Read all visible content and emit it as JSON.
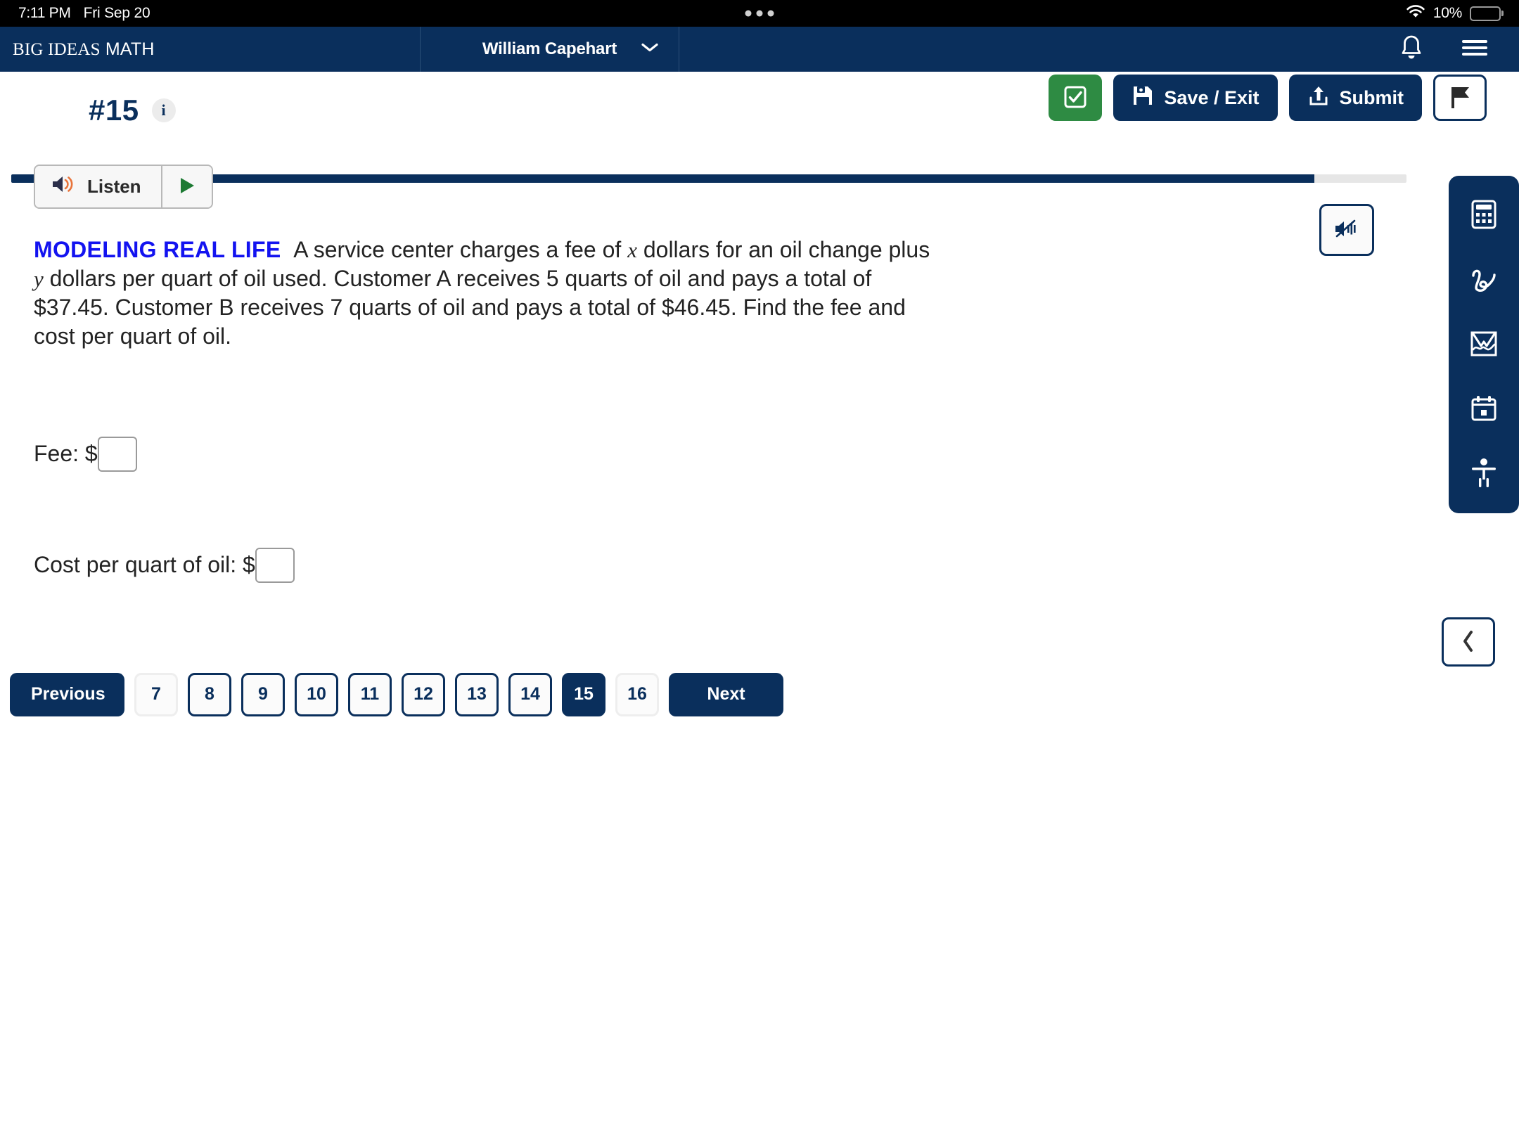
{
  "status_bar": {
    "time": "7:11 PM",
    "date": "Fri Sep 20",
    "battery_percent": "10%",
    "wifi_icon": "wifi-icon",
    "battery_icon": "battery-icon"
  },
  "header": {
    "brand_primary": "BIG IDEAS",
    "brand_secondary": "MATH",
    "user_name": "William Capehart",
    "user_caret_icon": "chevron-down-icon",
    "notification_icon": "bell-icon",
    "menu_icon": "hamburger-menu-icon"
  },
  "question_bar": {
    "number": "#15",
    "info_icon": "i",
    "check_label": "check-answer",
    "save_exit_label": "Save / Exit",
    "submit_label": "Submit",
    "flag_label": "flag-question",
    "progress_percent": 93.4
  },
  "audio": {
    "listen_label": "Listen",
    "speaker_icon": "speaker-icon",
    "play_icon": "play-icon",
    "mute_icon": "speaker-mute-icon"
  },
  "question": {
    "tag": "MODELING REAL LIFE",
    "part1": "A service center charges a fee of ",
    "var_x": "x",
    "part2": " dollars for an oil change plus ",
    "var_y": "y",
    "part3": " dollars per quart of oil used. Customer A receives 5 quarts of oil and pays a total of $37.45. Customer B receives 7 quarts of oil and pays a total of $46.45. Find the fee and cost per quart of oil."
  },
  "answers": [
    {
      "label": "Fee: $",
      "value": "",
      "name": "fee-input"
    },
    {
      "label": "Cost per quart of oil: $",
      "value": "",
      "name": "cost-per-quart-input"
    }
  ],
  "pagination": {
    "previous_label": "Previous",
    "next_label": "Next",
    "pages": [
      {
        "label": "7",
        "state": "muted"
      },
      {
        "label": "8",
        "state": "normal"
      },
      {
        "label": "9",
        "state": "normal"
      },
      {
        "label": "10",
        "state": "normal"
      },
      {
        "label": "11",
        "state": "normal"
      },
      {
        "label": "12",
        "state": "normal"
      },
      {
        "label": "13",
        "state": "normal"
      },
      {
        "label": "14",
        "state": "normal"
      },
      {
        "label": "15",
        "state": "active"
      },
      {
        "label": "16",
        "state": "muted"
      }
    ]
  },
  "tool_rail": {
    "items": [
      {
        "name": "calculator-icon",
        "label": "Calculator"
      },
      {
        "name": "scribble-icon",
        "label": "Scratchpad"
      },
      {
        "name": "graph-icon",
        "label": "Graphing Tool"
      },
      {
        "name": "tools-icon",
        "label": "Tools"
      },
      {
        "name": "accessibility-icon",
        "label": "Accessibility"
      }
    ],
    "collapse_icon": "chevron-left-icon"
  },
  "colors": {
    "brand_navy": "#0a2f5c",
    "accent_green": "#2e8b43",
    "tag_blue": "#1313f0",
    "battery_yellow": "#f5c518",
    "speaker_orange": "#e8743b"
  }
}
